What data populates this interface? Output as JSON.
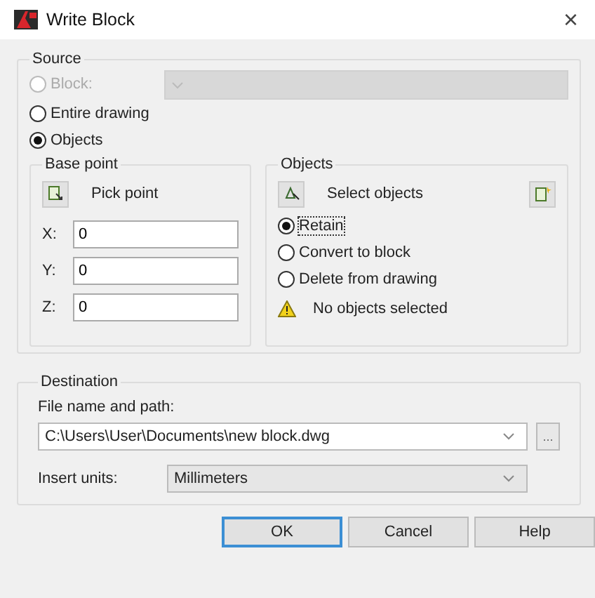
{
  "window": {
    "title": "Write Block",
    "close": "×"
  },
  "source": {
    "label": "Source",
    "options": [
      {
        "label": "Block:",
        "selected": false,
        "disabled": true
      },
      {
        "label": "Entire drawing",
        "selected": false,
        "disabled": false
      },
      {
        "label": "Objects",
        "selected": true,
        "disabled": false
      }
    ]
  },
  "base_point": {
    "label": "Base point",
    "pick_button": "Pick point",
    "fields": [
      {
        "label": "X:",
        "value": "0"
      },
      {
        "label": "Y:",
        "value": "0"
      },
      {
        "label": "Z:",
        "value": "0"
      }
    ]
  },
  "objects": {
    "label": "Objects",
    "select_button": "Select objects",
    "options": [
      {
        "label": "Retain",
        "selected": true,
        "focused": true
      },
      {
        "label": "Convert to block",
        "selected": false,
        "focused": false
      },
      {
        "label": "Delete from drawing",
        "selected": false,
        "focused": false
      }
    ],
    "warning": "No objects selected"
  },
  "destination": {
    "label": "Destination",
    "file_label": "File name and path:",
    "file_path": "C:\\Users\\User\\Documents\\new block.dwg",
    "browse_button": "...",
    "units_label": "Insert units:",
    "units": "Millimeters"
  },
  "buttons": [
    {
      "label": "OK",
      "default": true
    },
    {
      "label": "Cancel",
      "default": false
    },
    {
      "label": "Help",
      "default": false
    }
  ]
}
